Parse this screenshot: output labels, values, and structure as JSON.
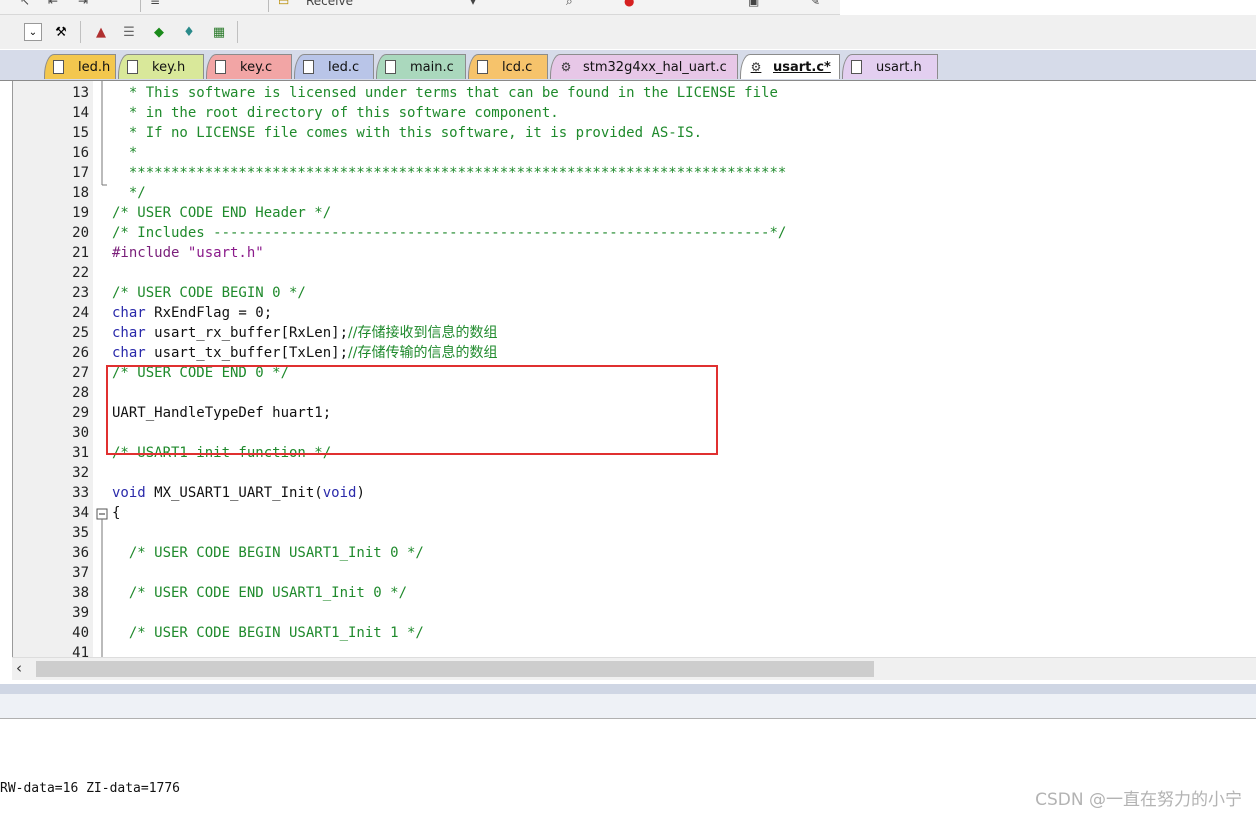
{
  "toolbar": {
    "top_items": [
      "Receive"
    ],
    "icons": [
      "collapse-icon",
      "wrench-icon",
      "stack-icon",
      "layers-icon",
      "diamond-icon",
      "gem-icon",
      "books-icon"
    ]
  },
  "tabs": [
    {
      "label": "led.h",
      "color": "#f3c74e",
      "active": false,
      "icon": "file-icon"
    },
    {
      "label": "key.h",
      "color": "#d9e89a",
      "active": false,
      "icon": "file-icon"
    },
    {
      "label": "key.c",
      "color": "#f2a5a5",
      "active": false,
      "icon": "file-icon"
    },
    {
      "label": "led.c",
      "color": "#b9c5e8",
      "active": false,
      "icon": "file-icon"
    },
    {
      "label": "main.c",
      "color": "#aad8bd",
      "active": false,
      "icon": "file-icon"
    },
    {
      "label": "lcd.c",
      "color": "#f6c36b",
      "active": false,
      "icon": "file-icon"
    },
    {
      "label": "stm32g4xx_hal_uart.c",
      "color": "#e7c7e7",
      "active": false,
      "icon": "gear-file-icon"
    },
    {
      "label": "usart.c*",
      "color": "#ffffff",
      "active": true,
      "icon": "gear-file-icon"
    },
    {
      "label": "usart.h",
      "color": "#e3cff0",
      "active": false,
      "icon": "file-icon"
    }
  ],
  "code_lines": [
    {
      "num": "13",
      "tokens": [
        {
          "t": "  * This software is licensed under terms that can be found in the LICENSE file",
          "c": "cmt"
        }
      ]
    },
    {
      "num": "14",
      "tokens": [
        {
          "t": "  * in the root directory of this software component.",
          "c": "cmt"
        }
      ]
    },
    {
      "num": "15",
      "tokens": [
        {
          "t": "  * If no LICENSE file comes with this software, it is provided AS-IS.",
          "c": "cmt"
        }
      ]
    },
    {
      "num": "16",
      "tokens": [
        {
          "t": "  *",
          "c": "cmt"
        }
      ]
    },
    {
      "num": "17",
      "tokens": [
        {
          "t": "  ******************************************************************************",
          "c": "cmt"
        }
      ]
    },
    {
      "num": "18",
      "tokens": [
        {
          "t": "  */",
          "c": "cmt"
        }
      ]
    },
    {
      "num": "19",
      "tokens": [
        {
          "t": "/* USER CODE END Header */",
          "c": "cmt"
        }
      ]
    },
    {
      "num": "20",
      "tokens": [
        {
          "t": "/* Includes ------------------------------------------------------------------*/",
          "c": "cmt"
        }
      ]
    },
    {
      "num": "21",
      "tokens": [
        {
          "t": "#include ",
          "c": "pre"
        },
        {
          "t": "\"usart.h\"",
          "c": "str"
        }
      ]
    },
    {
      "num": "22",
      "tokens": []
    },
    {
      "num": "23",
      "tokens": [
        {
          "t": "/* USER CODE BEGIN 0 */",
          "c": "cmt"
        }
      ]
    },
    {
      "num": "24",
      "tokens": [
        {
          "t": "char",
          "c": "kw"
        },
        {
          "t": " RxEndFlag = 0;",
          "c": "plain"
        }
      ]
    },
    {
      "num": "25",
      "tokens": [
        {
          "t": "char",
          "c": "kw"
        },
        {
          "t": " usart_rx_buffer[RxLen];",
          "c": "plain"
        },
        {
          "t": "//存储接收到信息的数组",
          "c": "cmt"
        }
      ]
    },
    {
      "num": "26",
      "tokens": [
        {
          "t": "char",
          "c": "kw"
        },
        {
          "t": " usart_tx_buffer[TxLen];",
          "c": "plain"
        },
        {
          "t": "//存储传输的信息的数组",
          "c": "cmt"
        }
      ]
    },
    {
      "num": "27",
      "tokens": [
        {
          "t": "/* USER CODE END 0 */",
          "c": "cmt"
        }
      ]
    },
    {
      "num": "28",
      "tokens": []
    },
    {
      "num": "29",
      "tokens": [
        {
          "t": "UART_HandleTypeDef huart1;",
          "c": "plain"
        }
      ]
    },
    {
      "num": "30",
      "tokens": []
    },
    {
      "num": "31",
      "tokens": [
        {
          "t": "/* USART1 init function */",
          "c": "cmt"
        }
      ]
    },
    {
      "num": "32",
      "tokens": []
    },
    {
      "num": "33",
      "tokens": [
        {
          "t": "void",
          "c": "kw"
        },
        {
          "t": " MX_USART1_UART_Init(",
          "c": "plain"
        },
        {
          "t": "void",
          "c": "kw"
        },
        {
          "t": ")",
          "c": "plain"
        }
      ]
    },
    {
      "num": "34",
      "tokens": [
        {
          "t": "{",
          "c": "plain"
        }
      ]
    },
    {
      "num": "35",
      "tokens": []
    },
    {
      "num": "36",
      "tokens": [
        {
          "t": "  /* USER CODE BEGIN USART1_Init 0 */",
          "c": "cmt"
        }
      ]
    },
    {
      "num": "37",
      "tokens": []
    },
    {
      "num": "38",
      "tokens": [
        {
          "t": "  /* USER CODE END USART1_Init 0 */",
          "c": "cmt"
        }
      ]
    },
    {
      "num": "39",
      "tokens": []
    },
    {
      "num": "40",
      "tokens": [
        {
          "t": "  /* USER CODE BEGIN USART1_Init 1 */",
          "c": "cmt"
        }
      ]
    },
    {
      "num": "41",
      "tokens": []
    }
  ],
  "build_output": "RW-data=16 ZI-data=1776",
  "watermark": "CSDN @一直在努力的小宁",
  "colors": {
    "highlight_box": "#e03030",
    "comment": "#1f8a2c",
    "keyword": "#2a2aaa"
  }
}
